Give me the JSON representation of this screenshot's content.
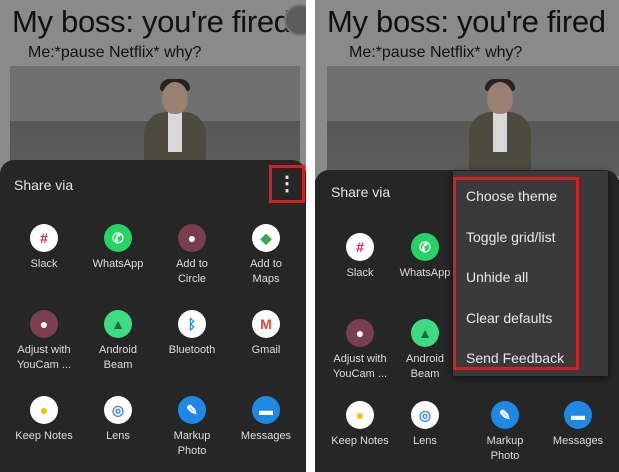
{
  "meme": {
    "title": "My boss: you're fired",
    "caption": "Me:*pause Netflix*  why?"
  },
  "share_sheet": {
    "title": "Share via"
  },
  "apps": [
    {
      "label": "Slack",
      "icon": "slack-icon",
      "color": "#ffffff"
    },
    {
      "label": "WhatsApp",
      "icon": "whatsapp-icon",
      "color": "#25d366"
    },
    {
      "label": "Add to\nCircle",
      "icon": "circle-icon",
      "color": "#7a3f4f"
    },
    {
      "label": "Add to\nMaps",
      "icon": "maps-icon",
      "color": "#ffffff"
    },
    {
      "label": "Adjust with\nYouCam ...",
      "icon": "youcam-icon",
      "color": "#7a3f4f"
    },
    {
      "label": "Android\nBeam",
      "icon": "android-icon",
      "color": "#3ddc84"
    },
    {
      "label": "Bluetooth",
      "icon": "bluetooth-icon",
      "color": "#ffffff"
    },
    {
      "label": "Gmail",
      "icon": "gmail-icon",
      "color": "#ffffff"
    },
    {
      "label": "Keep Notes",
      "icon": "keep-icon",
      "color": "#ffffff"
    },
    {
      "label": "Lens",
      "icon": "lens-icon",
      "color": "#ffffff"
    },
    {
      "label": "Markup\nPhoto",
      "icon": "markup-icon",
      "color": "#1e88e5"
    },
    {
      "label": "Messages",
      "icon": "messages-icon",
      "color": "#1e88e5"
    }
  ],
  "overflow_menu": {
    "items": [
      "Choose theme",
      "Toggle grid/list",
      "Unhide all",
      "Clear defaults",
      "Send Feedback"
    ]
  },
  "colors": {
    "highlight": "#d62020",
    "sheet_bg": "#262626",
    "menu_bg": "#3a3a3a"
  }
}
